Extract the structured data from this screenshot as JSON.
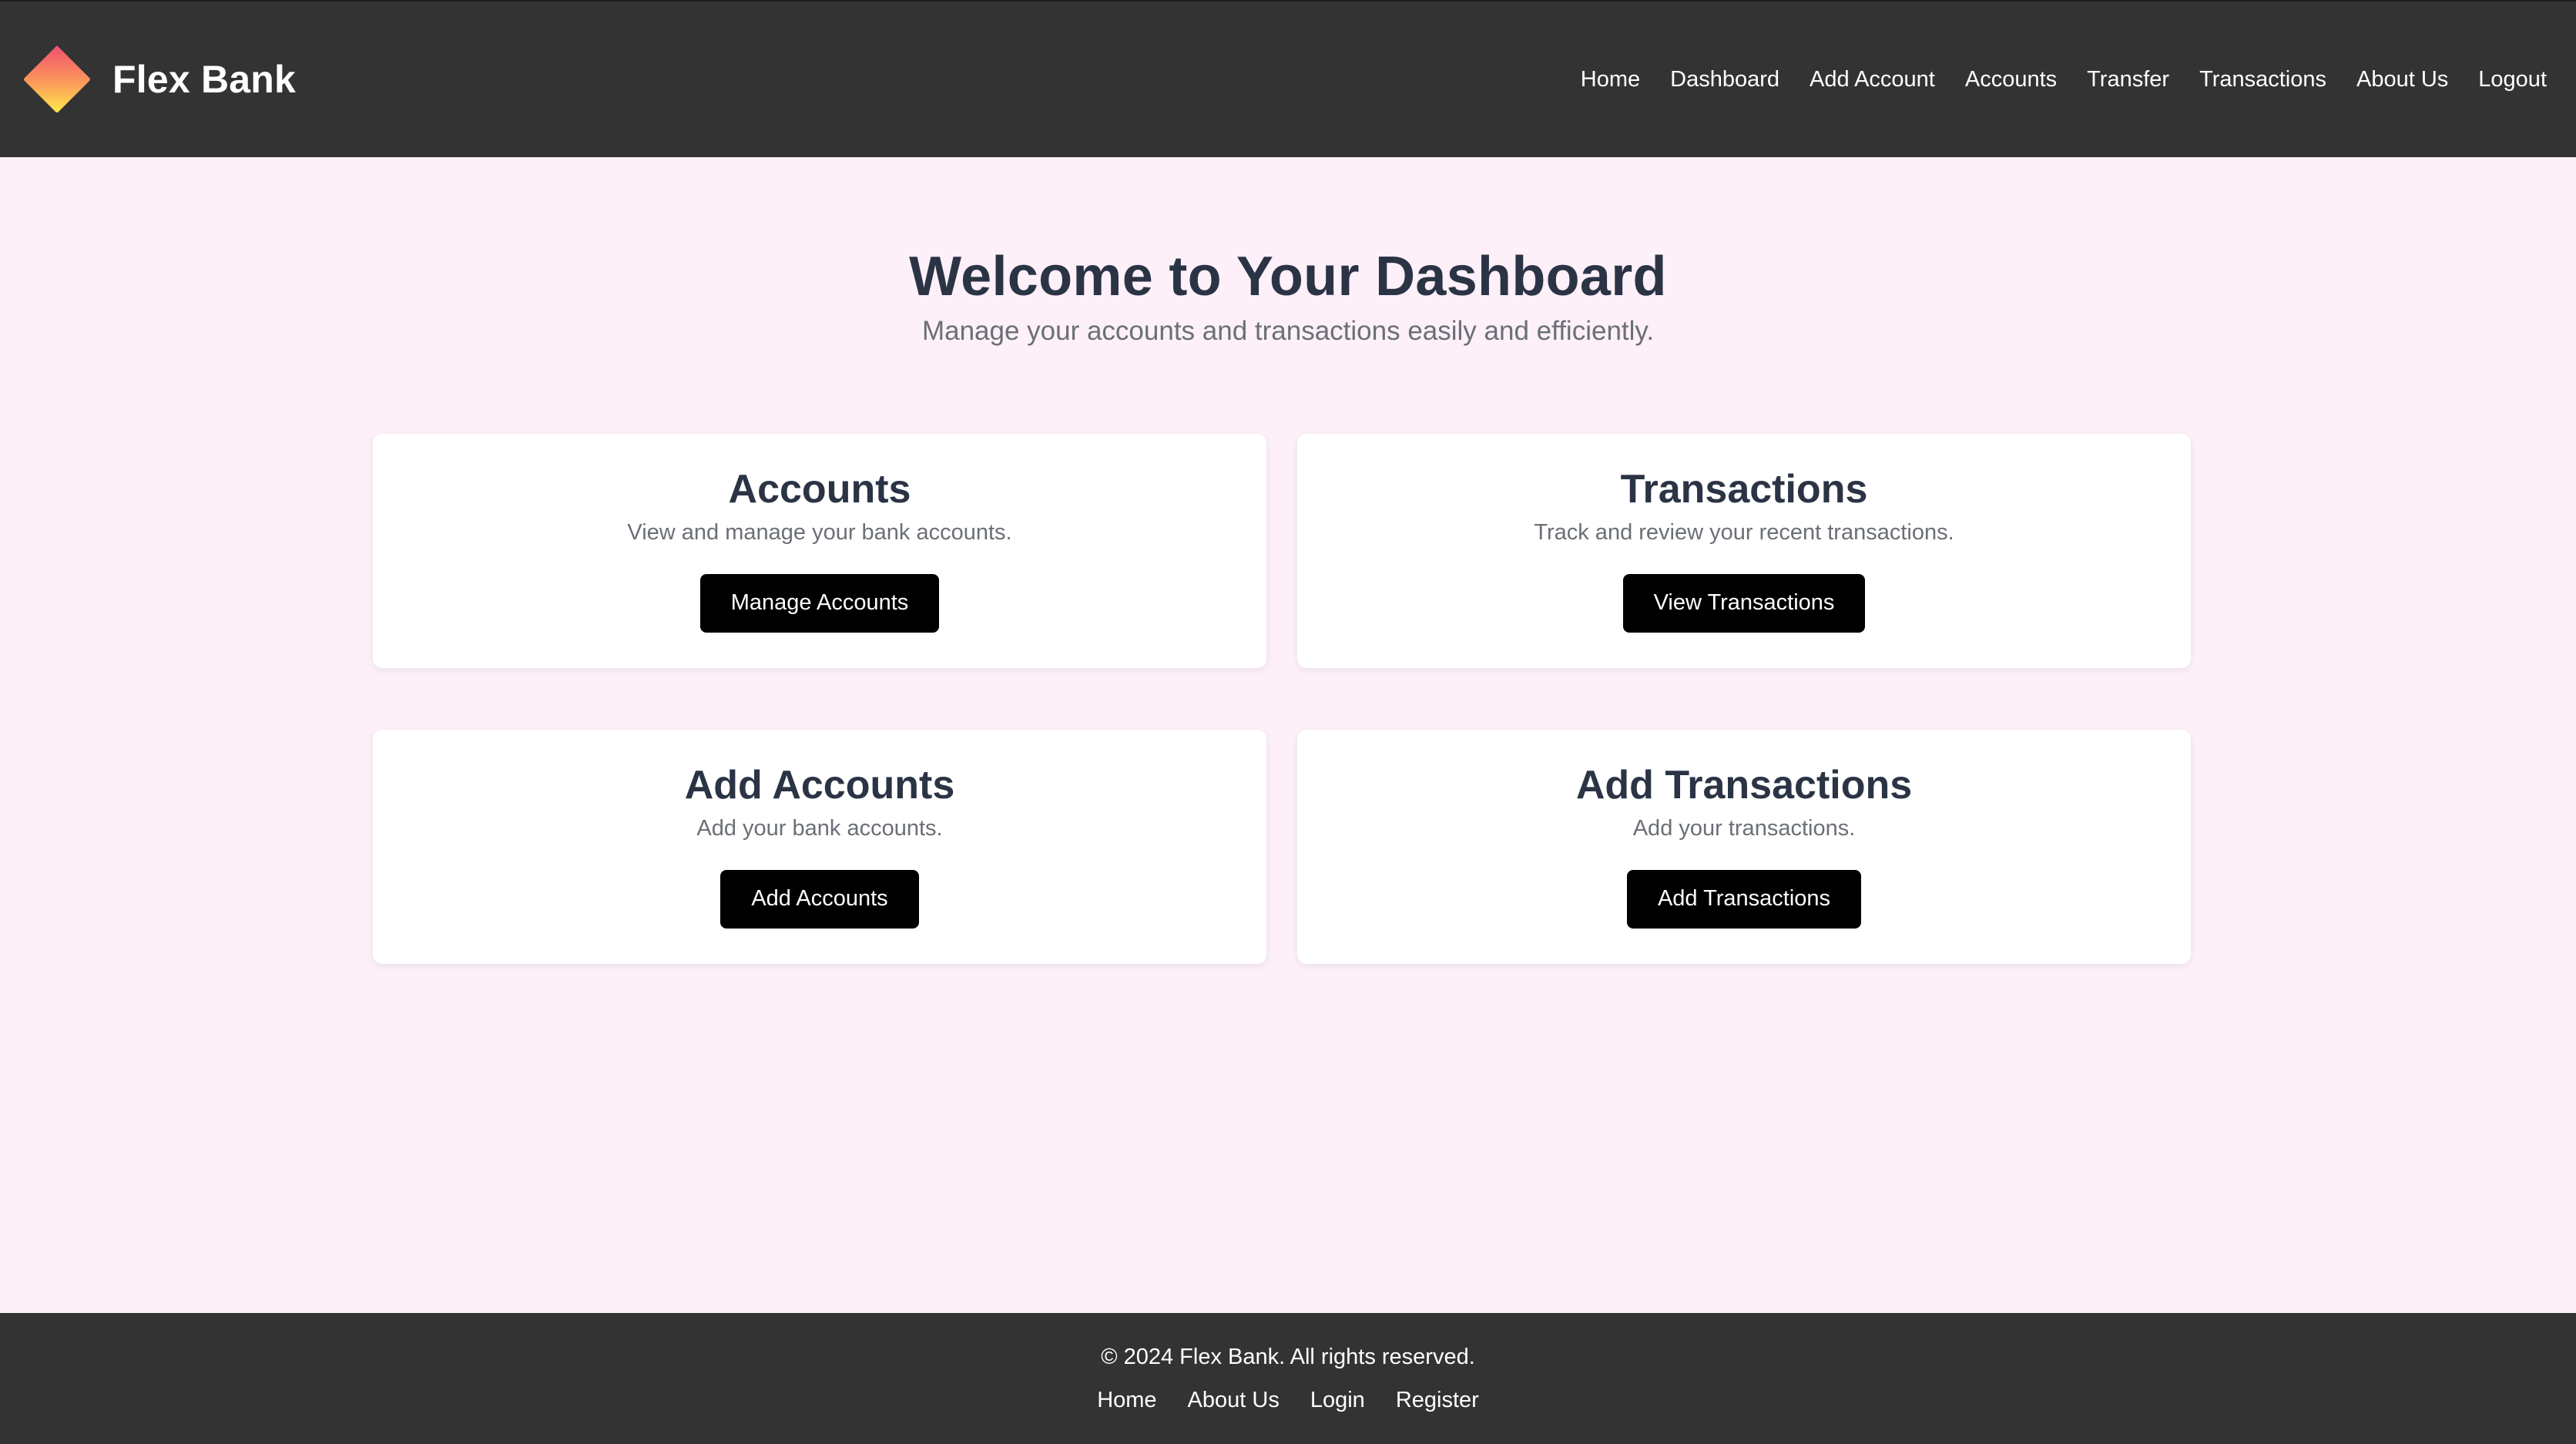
{
  "header": {
    "brand_name": "Flex Bank",
    "logo_icon": "diamond-gradient-logo",
    "nav": [
      {
        "label": "Home"
      },
      {
        "label": "Dashboard"
      },
      {
        "label": "Add Account"
      },
      {
        "label": "Accounts"
      },
      {
        "label": "Transfer"
      },
      {
        "label": "Transactions"
      },
      {
        "label": "About Us"
      },
      {
        "label": "Logout"
      }
    ]
  },
  "hero": {
    "title": "Welcome to Your Dashboard",
    "subtitle": "Manage your accounts and transactions easily and efficiently."
  },
  "cards": [
    {
      "title": "Accounts",
      "description": "View and manage your bank accounts.",
      "button": "Manage Accounts"
    },
    {
      "title": "Transactions",
      "description": "Track and review your recent transactions.",
      "button": "View Transactions"
    },
    {
      "title": "Add Accounts",
      "description": "Add your bank accounts.",
      "button": "Add Accounts"
    },
    {
      "title": "Add Transactions",
      "description": "Add your transactions.",
      "button": "Add Transactions"
    }
  ],
  "footer": {
    "copyright": "© 2024 Flex Bank. All rights reserved.",
    "links": [
      {
        "label": "Home"
      },
      {
        "label": "About Us"
      },
      {
        "label": "Login"
      },
      {
        "label": "Register"
      }
    ]
  },
  "colors": {
    "header_bg": "#333333",
    "page_bg": "#fdf0f9",
    "heading": "#2b3445",
    "muted_text": "#6b6f76",
    "button_bg": "#000000",
    "logo_gradient_top": "#f0506e",
    "logo_gradient_bottom": "#ffe84a"
  }
}
